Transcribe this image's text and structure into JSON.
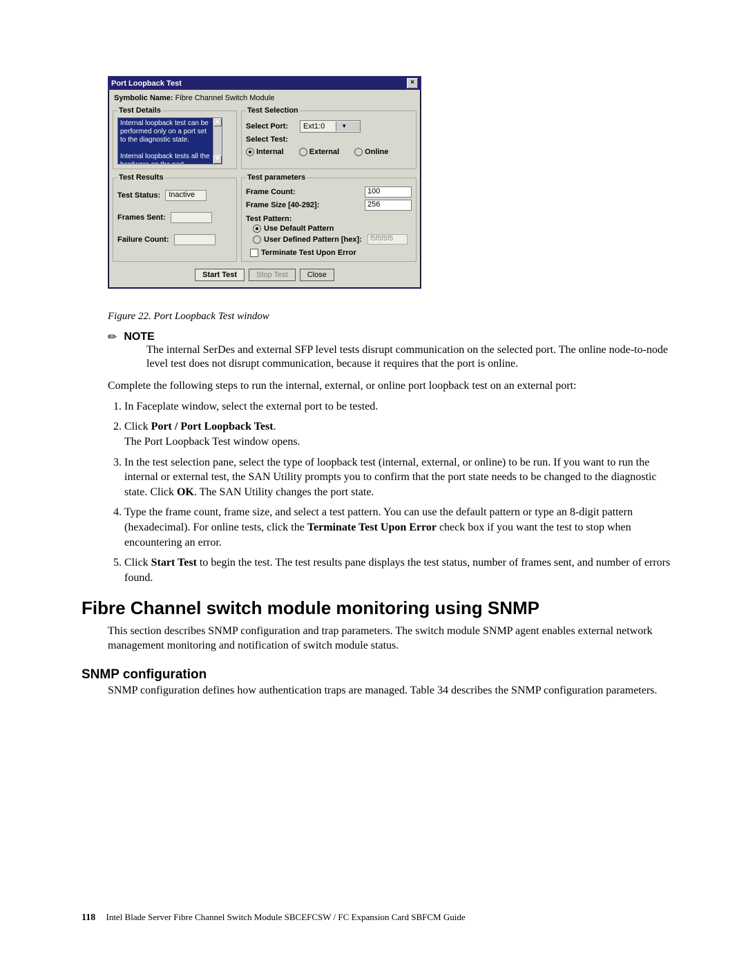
{
  "dialog": {
    "title": "Port Loopback Test",
    "close": "×",
    "symbolicLabel": "Symbolic Name:",
    "symbolicValue": "Fibre Channel Switch Module",
    "details": {
      "legend": "Test Details",
      "text1": "Internal loopback test can be performed only on a port set to the diagnostic state.",
      "text2": "Internal loopback tests all the hardware on the port,"
    },
    "selection": {
      "legend": "Test Selection",
      "selectPortLabel": "Select Port:",
      "selectPortValue": "Ext1:0",
      "selectTestLabel": "Select Test:",
      "optInternal": "Internal",
      "optExternal": "External",
      "optOnline": "Online"
    },
    "results": {
      "legend": "Test Results",
      "statusLabel": "Test Status:",
      "statusValue": "Inactive",
      "framesLabel": "Frames Sent:",
      "framesValue": "",
      "failLabel": "Failure Count:",
      "failValue": ""
    },
    "params": {
      "legend": "Test parameters",
      "frameCountLabel": "Frame Count:",
      "frameCountValue": "100",
      "frameSizeLabel": "Frame Size [40-292]:",
      "frameSizeValue": "256",
      "testPatternLabel": "Test Pattern:",
      "useDefault": "Use Default Pattern",
      "userDefLabel": "User Defined Pattern [hex]:",
      "userDefValue": "f5f5f5f5",
      "terminate": "Terminate Test Upon Error"
    },
    "buttons": {
      "start": "Start Test",
      "stop": "Stop Test",
      "close": "Close"
    }
  },
  "doc": {
    "caption": "Figure 22. Port Loopback Test window",
    "noteHead": "NOTE",
    "noteBody": "The internal SerDes and external SFP level tests disrupt communication on the selected port. The online node-to-node level test does not disrupt communication, because it requires that the port is online.",
    "intro": "Complete the following steps to run the internal, external, or online port loopback test on an external port:",
    "step1": "In Faceplate window, select the external port to be tested.",
    "step2a": "Click ",
    "step2b": "Port / Port Loopback Test",
    "step2c": ".",
    "step2sub": "The Port Loopback Test window opens.",
    "step3a": "In the test selection pane, select the type of loopback test (internal, external, or online) to be run. If you want to run the internal or external test, the SAN Utility prompts you to confirm that the port state needs to be changed to the diagnostic state. Click ",
    "step3b": "OK",
    "step3c": ". The SAN Utility changes the port state.",
    "step4a": "Type the frame count, frame size, and select a test pattern. You can use the default pattern or type an 8-digit pattern (hexadecimal). For online tests, click the ",
    "step4b": "Terminate Test Upon Error",
    "step4c": " check box if you want the test to stop when encountering an error.",
    "step5a": "Click ",
    "step5b": "Start Test",
    "step5c": " to begin the test. The test results pane displays the test status, number of frames sent, and number of errors found.",
    "h1": "Fibre Channel switch module monitoring using SNMP",
    "h1para": "This section describes SNMP configuration and trap parameters. The switch module SNMP agent enables external network management monitoring and notification of switch module status.",
    "h2": "SNMP configuration",
    "h2para": "SNMP configuration defines how authentication traps are managed. Table 34 describes the SNMP configuration parameters."
  },
  "footer": {
    "page": "118",
    "text": "Intel Blade Server Fibre Channel Switch Module SBCEFCSW / FC Expansion Card SBFCM Guide"
  }
}
